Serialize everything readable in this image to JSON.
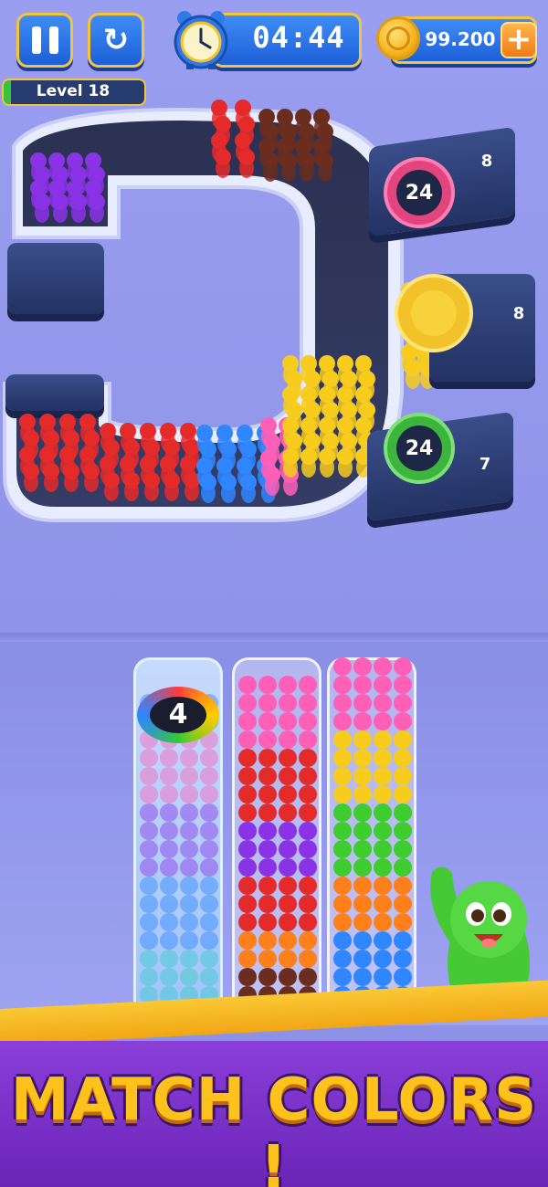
{
  "hud": {
    "timer": "04:44",
    "coins": "99.200",
    "level": "Level 18",
    "level_progress": 0.05
  },
  "docks": [
    {
      "badge_count": "24",
      "ring_color": "#e2457e",
      "capacity": "8"
    },
    {
      "badge_count": "",
      "ring_color": "#f2c22a",
      "capacity": "8"
    },
    {
      "badge_count": "24",
      "ring_color": "#3bb53c",
      "capacity": "7"
    }
  ],
  "ice_tube": {
    "count": "4"
  },
  "banner": {
    "text": "MATCH COLORS !"
  },
  "colors": {
    "red": "#e52a2a",
    "brown": "#6b2e1e",
    "purple": "#8a33e6",
    "yellow": "#f7cc1d",
    "pink": "#ff5fb7",
    "blue": "#2f86ff",
    "green": "#3fcc2e",
    "orange": "#ff7f1a",
    "teal": "#38c9c9"
  },
  "tube_stacks": [
    {
      "name": "tube-1",
      "rows": [
        "teal",
        "teal",
        "teal",
        "teal",
        "blue",
        "blue",
        "blue",
        "blue",
        "purple",
        "purple",
        "purple",
        "purple",
        "pink",
        "pink",
        "pink",
        "pink",
        "blue",
        "blue"
      ]
    },
    {
      "name": "tube-2",
      "rows": [
        "brown",
        "brown",
        "brown",
        "orange",
        "orange",
        "red",
        "red",
        "red",
        "purple",
        "purple",
        "purple",
        "red",
        "red",
        "red",
        "red",
        "pink",
        "pink",
        "pink",
        "pink"
      ]
    },
    {
      "name": "tube-3",
      "rows": [
        "blue",
        "blue",
        "blue",
        "blue",
        "blue",
        "orange",
        "orange",
        "orange",
        "green",
        "green",
        "green",
        "green",
        "yellow",
        "yellow",
        "yellow",
        "yellow",
        "pink",
        "pink",
        "pink",
        "pink"
      ]
    }
  ]
}
